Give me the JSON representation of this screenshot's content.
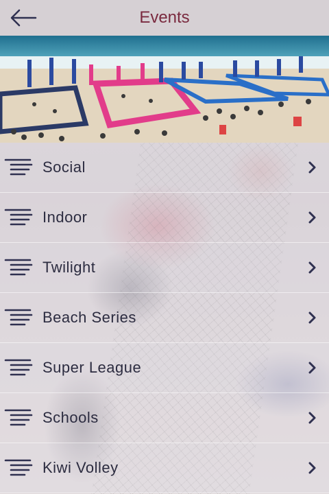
{
  "header": {
    "title": "Events",
    "back_icon": "back-arrow-icon"
  },
  "hero": {
    "image": "beach-volleyball-event-photo"
  },
  "menu": {
    "items": [
      {
        "label": "Social",
        "icon": "list-lines-icon"
      },
      {
        "label": "Indoor",
        "icon": "list-lines-icon"
      },
      {
        "label": "Twilight",
        "icon": "list-lines-icon"
      },
      {
        "label": "Beach Series",
        "icon": "list-lines-icon"
      },
      {
        "label": "Super League",
        "icon": "list-lines-icon"
      },
      {
        "label": "Schools",
        "icon": "list-lines-icon"
      },
      {
        "label": "Kiwi Volley",
        "icon": "list-lines-icon"
      }
    ]
  },
  "colors": {
    "title": "#7a2a3f",
    "text": "#2c2c40",
    "icon": "#2f3050"
  }
}
